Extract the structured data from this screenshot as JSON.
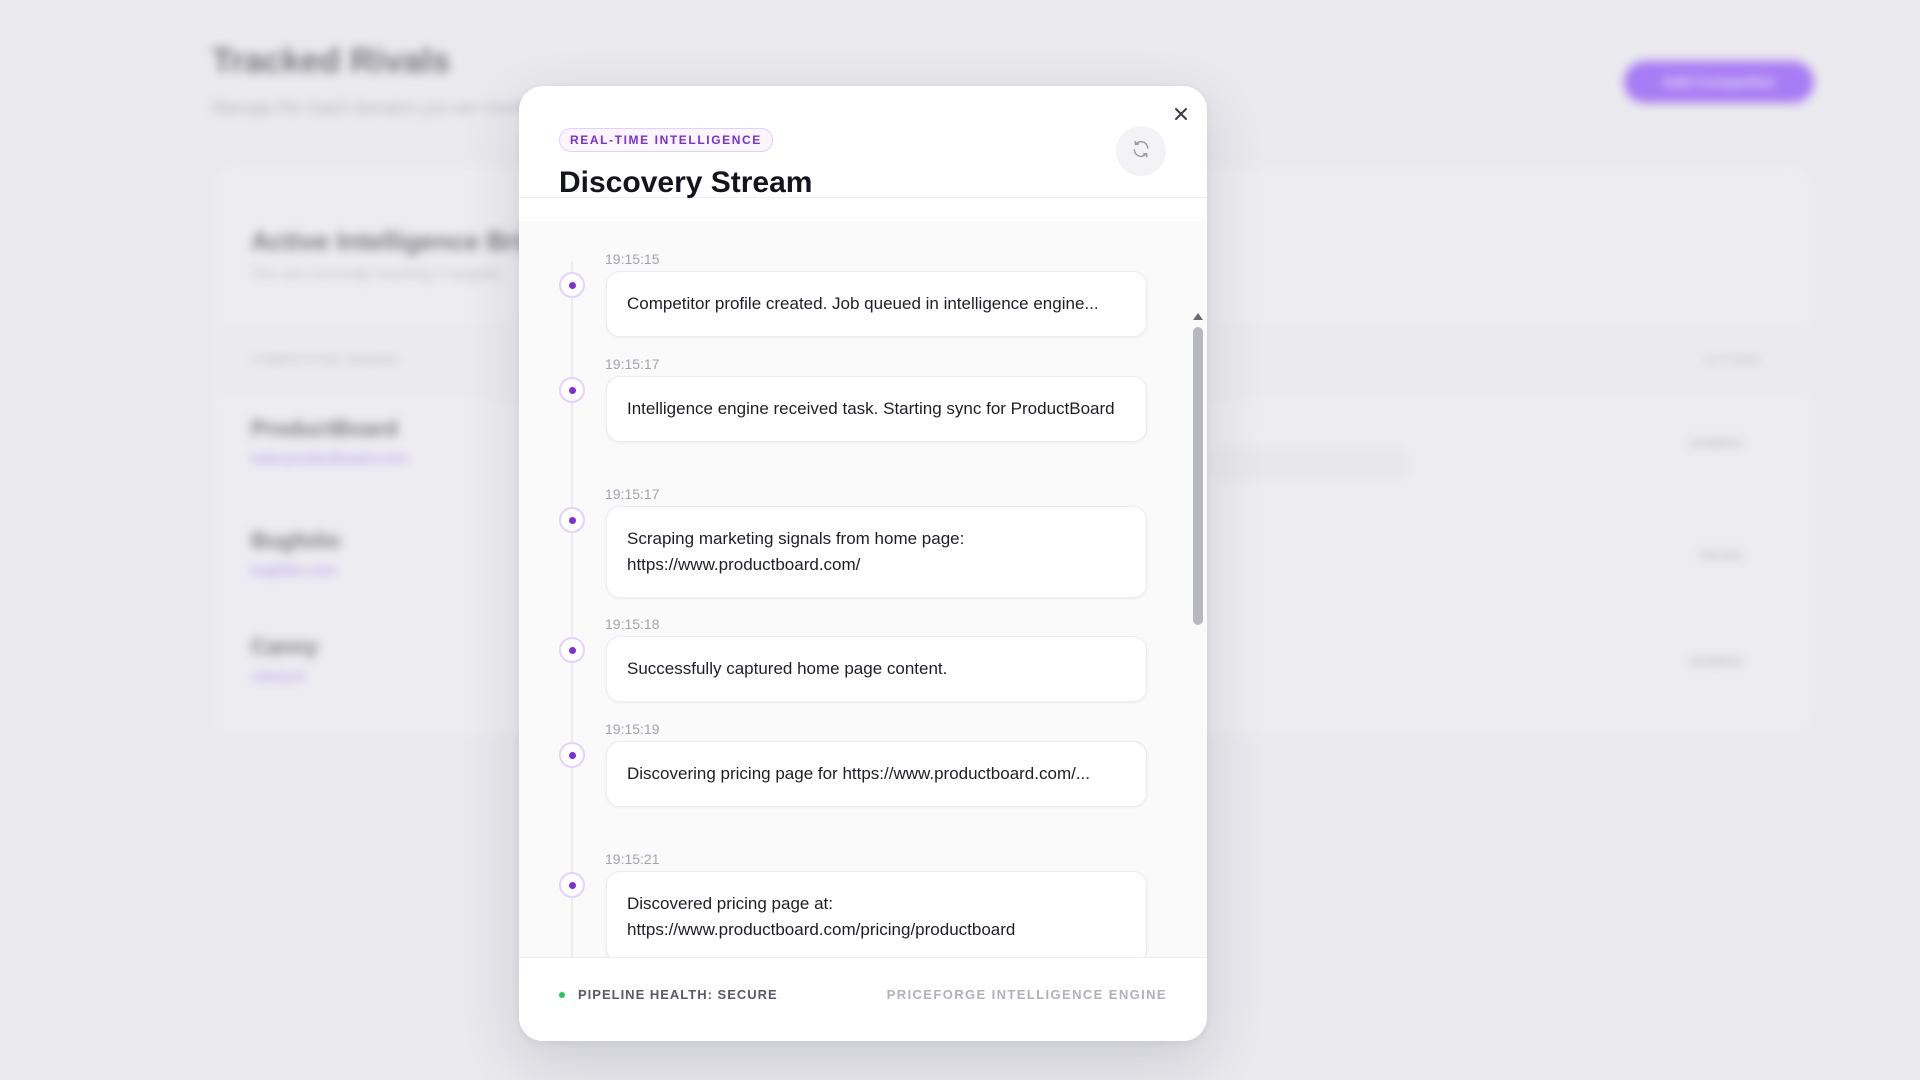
{
  "background": {
    "title": "Tracked Rivals",
    "subtitle": "Manage the SaaS domains you are monitoring.",
    "add_button": "Add Competitor",
    "card_title": "Active Intelligence Bridges",
    "card_subtitle": "You are currently tracking 3 targets.",
    "table_header_left": "COMPETITOR DOMAIN",
    "table_header_right": "ACTIONS",
    "rows": [
      {
        "name": "ProductBoard",
        "link": "www.productboard.com",
        "action": "DISMISS"
      },
      {
        "name": "Bugfolio",
        "link": "bugfolio.com",
        "action": "PAUSE"
      },
      {
        "name": "Canny",
        "link": "canny.io",
        "action": "DISMISS"
      }
    ]
  },
  "modal": {
    "badge": "REAL-TIME INTELLIGENCE",
    "title": "Discovery Stream",
    "close_icon": "close-icon",
    "refresh_icon": "refresh-icon",
    "events": [
      {
        "time": "19:15:15",
        "message": "Competitor profile created. Job queued in intelligence engine..."
      },
      {
        "time": "19:15:17",
        "message": "Intelligence engine received task. Starting sync for ProductBoard"
      },
      {
        "time": "19:15:17",
        "message": "Scraping marketing signals from home page: https://www.productboard.com/"
      },
      {
        "time": "19:15:18",
        "message": "Successfully captured home page content."
      },
      {
        "time": "19:15:19",
        "message": "Discovering pricing page for https://www.productboard.com/..."
      },
      {
        "time": "19:15:21",
        "message": "Discovered pricing page at: https://www.productboard.com/pricing/productboard"
      }
    ],
    "footer": {
      "health": "PIPELINE HEALTH: SECURE",
      "engine": "PRICEFORGE INTELLIGENCE ENGINE"
    }
  },
  "colors": {
    "accent": "#7a30d6",
    "health_ok": "#22c55e"
  }
}
